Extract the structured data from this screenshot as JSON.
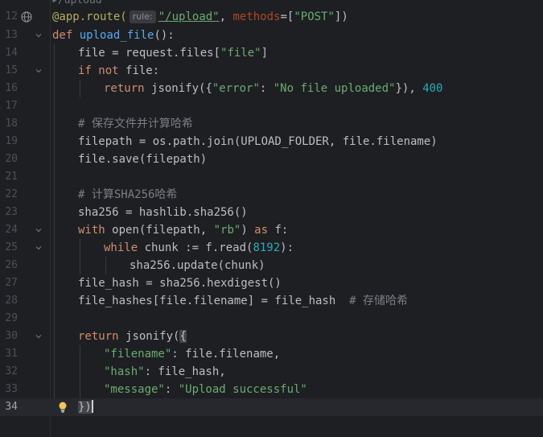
{
  "breadcrumb": "▸/upload",
  "hint_label": "rule:",
  "lines": {
    "l12": {
      "num": "12",
      "t1": "@app.route(",
      "t2": "\"/upload\"",
      "t3": ", ",
      "t4": "methods",
      "t5": "=[",
      "t6": "\"POST\"",
      "t7": "])"
    },
    "l13": {
      "num": "13",
      "t1": "def ",
      "t2": "upload_file",
      "t3": "():"
    },
    "l14": {
      "num": "14",
      "t1": "file = request.files[",
      "t2": "\"file\"",
      "t3": "]"
    },
    "l15": {
      "num": "15",
      "t1": "if not ",
      "t2": "file:"
    },
    "l16": {
      "num": "16",
      "t1": "return ",
      "t2": "jsonify({",
      "t3": "\"error\"",
      "t4": ": ",
      "t5": "\"No file uploaded\"",
      "t6": "}), ",
      "t7": "400"
    },
    "l17": {
      "num": "17"
    },
    "l18": {
      "num": "18",
      "t1": "# 保存文件并计算哈希"
    },
    "l19": {
      "num": "19",
      "t1": "filepath = os.path.join(UPLOAD_FOLDER, file.filename)"
    },
    "l20": {
      "num": "20",
      "t1": "file.save(filepath)"
    },
    "l21": {
      "num": "21"
    },
    "l22": {
      "num": "22",
      "t1": "# 计算SHA256哈希"
    },
    "l23": {
      "num": "23",
      "t1": "sha256 = hashlib.sha256()"
    },
    "l24": {
      "num": "24",
      "t1": "with ",
      "t2": "open(filepath, ",
      "t3": "\"rb\"",
      "t4": ") ",
      "t5": "as ",
      "t6": "f:"
    },
    "l25": {
      "num": "25",
      "t1": "while ",
      "t2": "chunk := f.read(",
      "t3": "8192",
      "t4": "):"
    },
    "l26": {
      "num": "26",
      "t1": "sha256.update(chunk)"
    },
    "l27": {
      "num": "27",
      "t1": "file_hash = sha256.hexdigest()"
    },
    "l28": {
      "num": "28",
      "t1": "file_hashes[file.filename] = file_hash  ",
      "t2": "# 存储哈希"
    },
    "l29": {
      "num": "29"
    },
    "l30": {
      "num": "30",
      "t1": "return ",
      "t2": "jsonify(",
      "t3": "{"
    },
    "l31": {
      "num": "31",
      "t1": "\"filename\"",
      "t2": ": file.filename,"
    },
    "l32": {
      "num": "32",
      "t1": "\"hash\"",
      "t2": ": file_hash,"
    },
    "l33": {
      "num": "33",
      "t1": "\"message\"",
      "t2": ": ",
      "t3": "\"Upload successful\""
    },
    "l34": {
      "num": "34",
      "t1": "})"
    }
  },
  "colors": {
    "background": "#1e1f22",
    "keyword": "#cf8e6d",
    "function": "#56a8f5",
    "string": "#6aab73",
    "number": "#2aacb8",
    "comment": "#7a7e85"
  },
  "icons": {
    "line12_gutter": "globe-icon",
    "line34_gutter": "lightbulb-icon",
    "fold": "chevron-down-icon"
  }
}
